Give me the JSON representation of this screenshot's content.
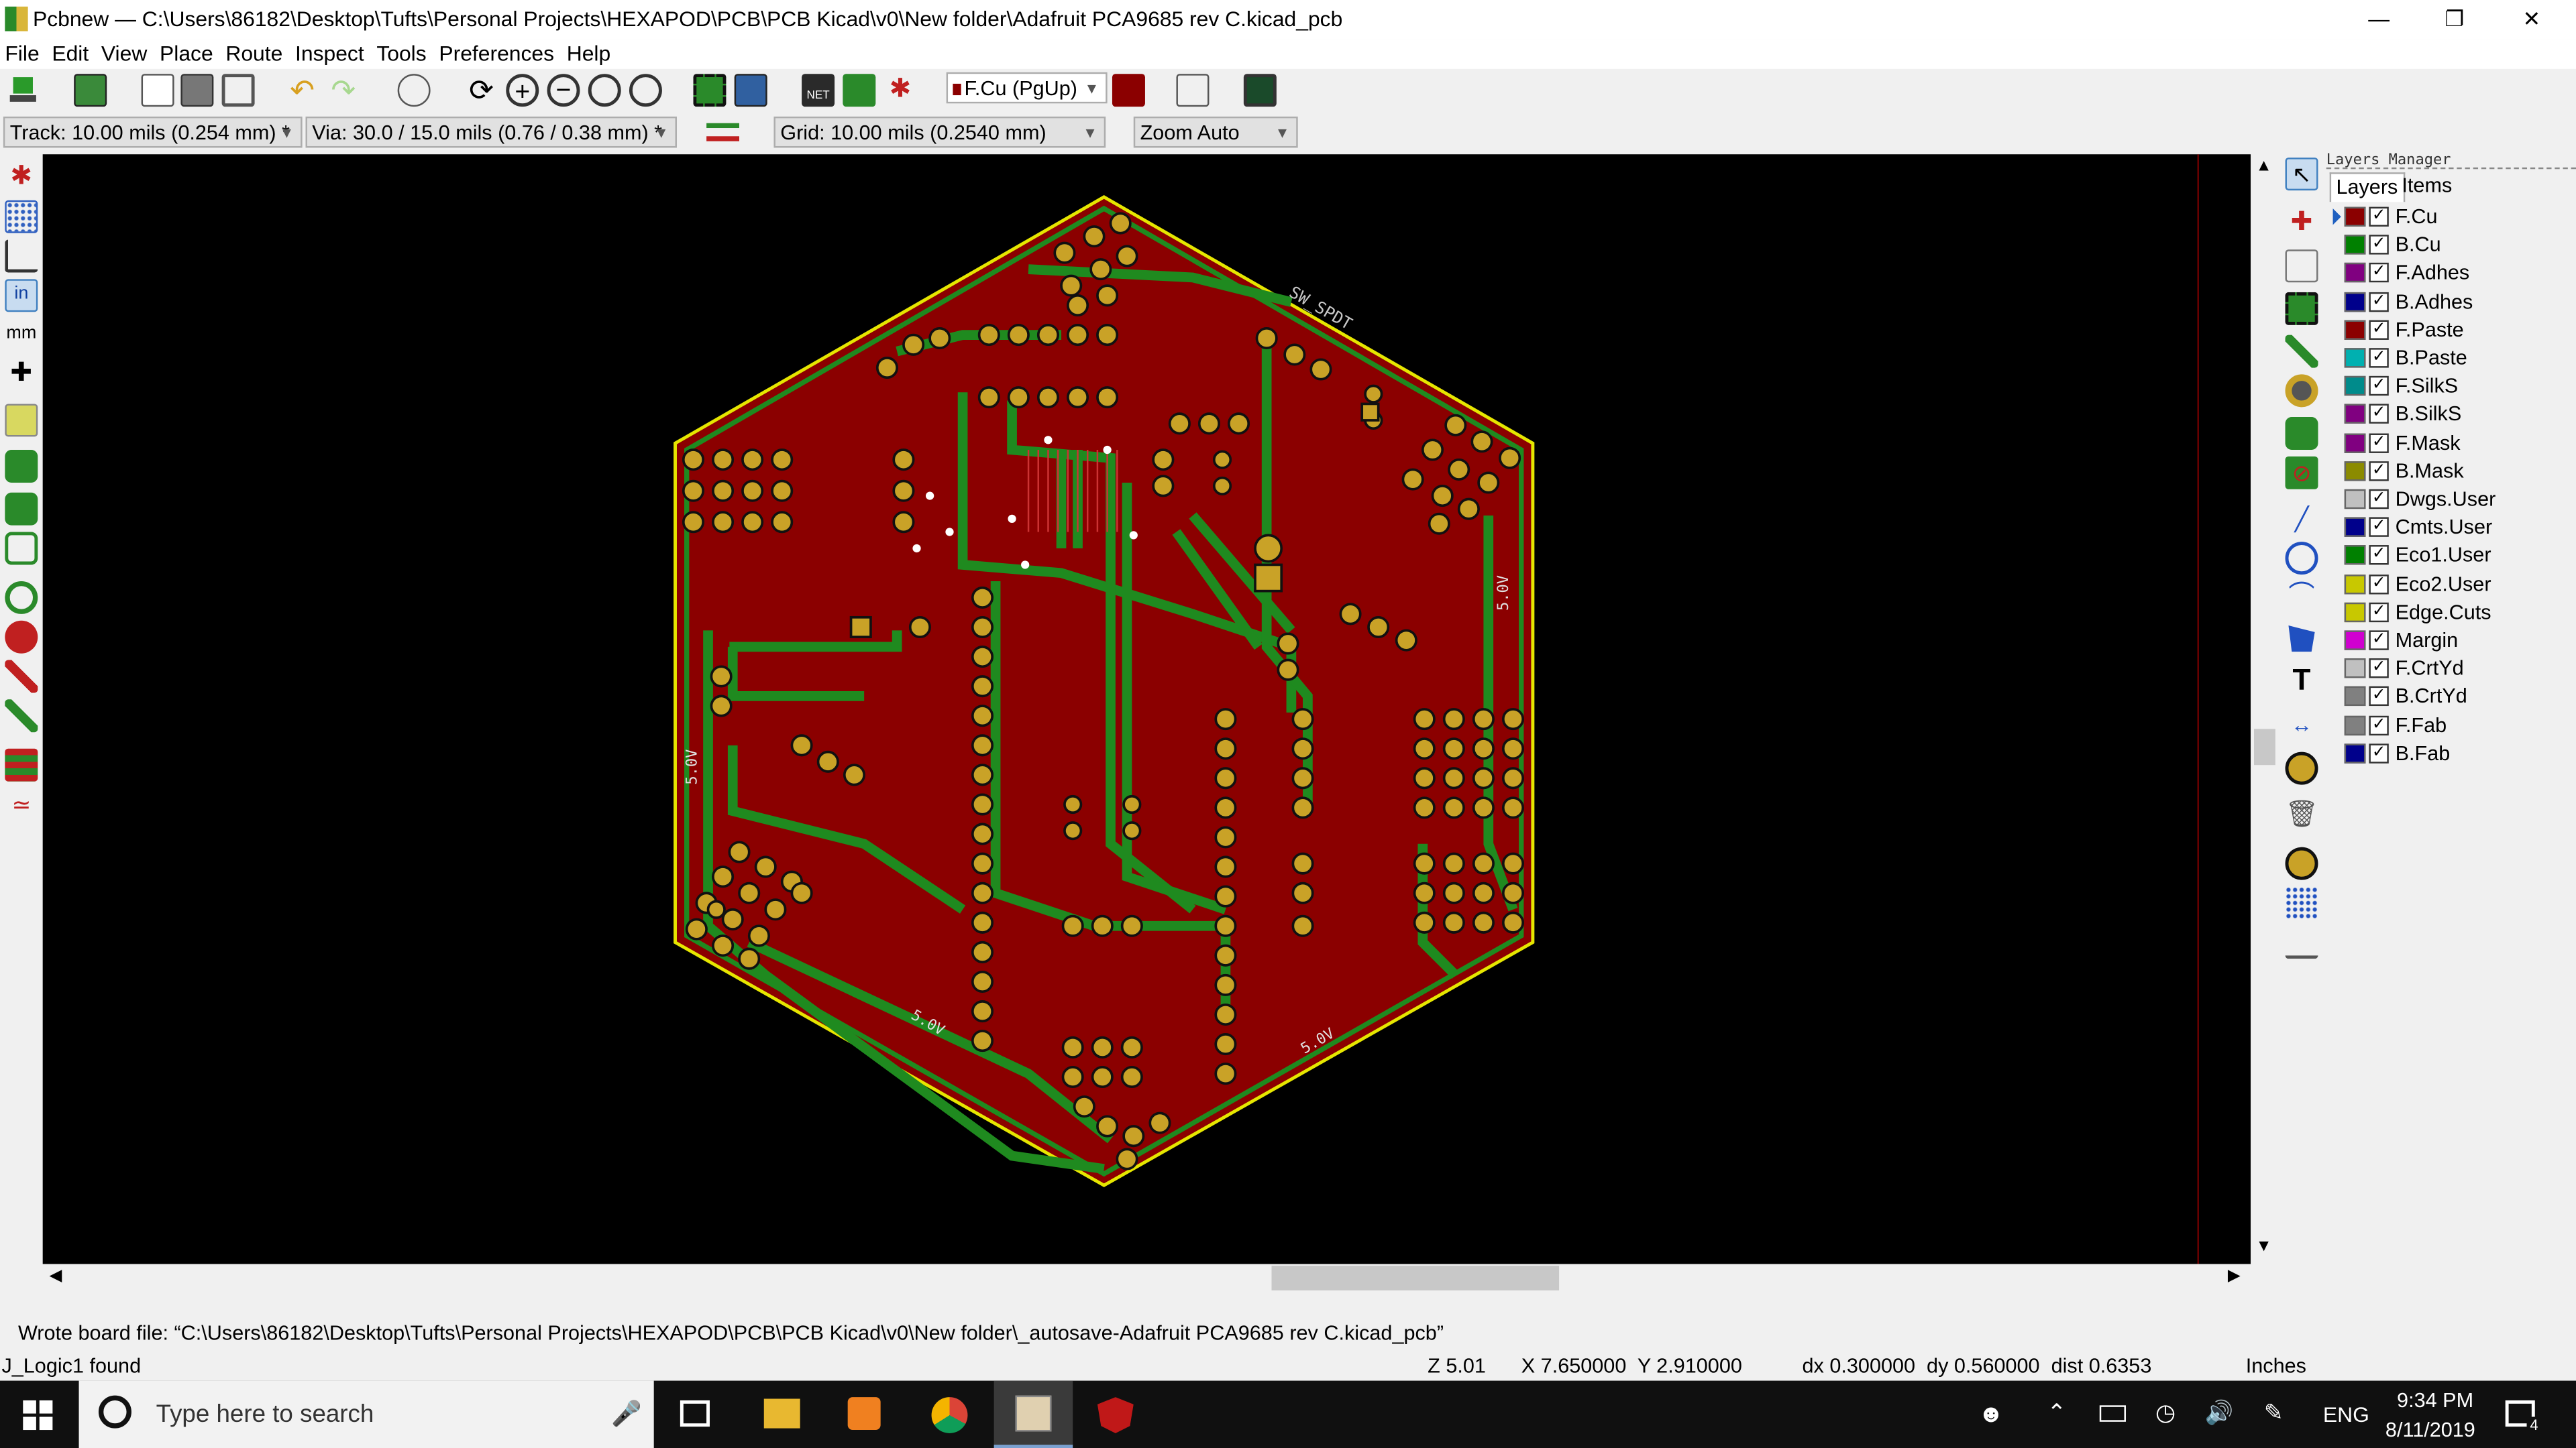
{
  "window": {
    "title": "Pcbnew — C:\\Users\\86182\\Desktop\\Tufts\\Personal Projects\\HEXAPOD\\PCB\\PCB Kicad\\v0\\New folder\\Adafruit PCA9685 rev C.kicad_pcb"
  },
  "menu": [
    "File",
    "Edit",
    "View",
    "Place",
    "Route",
    "Inspect",
    "Tools",
    "Preferences",
    "Help"
  ],
  "toolbar": {
    "layer_select": "F.Cu (PgUp)",
    "track": "Track: 10.00 mils (0.254 mm) *",
    "via": "Via: 30.0 / 15.0 mils (0.76 / 0.38 mm) *",
    "grid": "Grid: 10.00 mils (0.2540 mm)",
    "zoom": "Zoom Auto"
  },
  "left_toolbar_units": {
    "inch": "in",
    "mm": "mm"
  },
  "board": {
    "silk_labels": [
      "SW_SPDT",
      "5.0V",
      "5.0V",
      "5.0V",
      "5.0V"
    ],
    "colors": {
      "copper_fill": "#8b0000",
      "trace": "#1f8a1f",
      "pad": "#c9a227",
      "edge": "#e0e000"
    }
  },
  "layers_manager": {
    "title": "Layers Manager",
    "tabs": [
      "Layers",
      "Items"
    ],
    "active_layer": "F.Cu",
    "layers": [
      {
        "name": "F.Cu",
        "color": "#8b0000",
        "checked": true
      },
      {
        "name": "B.Cu",
        "color": "#008000",
        "checked": true
      },
      {
        "name": "F.Adhes",
        "color": "#800080",
        "checked": true
      },
      {
        "name": "B.Adhes",
        "color": "#00008b",
        "checked": true
      },
      {
        "name": "F.Paste",
        "color": "#8b0000",
        "checked": true
      },
      {
        "name": "B.Paste",
        "color": "#00b0b0",
        "checked": true
      },
      {
        "name": "F.SilkS",
        "color": "#008b8b",
        "checked": true
      },
      {
        "name": "B.SilkS",
        "color": "#800080",
        "checked": true
      },
      {
        "name": "F.Mask",
        "color": "#800080",
        "checked": true
      },
      {
        "name": "B.Mask",
        "color": "#8b8b00",
        "checked": true
      },
      {
        "name": "Dwgs.User",
        "color": "#c0c0c0",
        "checked": true
      },
      {
        "name": "Cmts.User",
        "color": "#00008b",
        "checked": true
      },
      {
        "name": "Eco1.User",
        "color": "#008000",
        "checked": true
      },
      {
        "name": "Eco2.User",
        "color": "#c8c800",
        "checked": true
      },
      {
        "name": "Edge.Cuts",
        "color": "#c8c800",
        "checked": true
      },
      {
        "name": "Margin",
        "color": "#d000d0",
        "checked": true
      },
      {
        "name": "F.CrtYd",
        "color": "#c0c0c0",
        "checked": true
      },
      {
        "name": "B.CrtYd",
        "color": "#808080",
        "checked": true
      },
      {
        "name": "F.Fab",
        "color": "#808080",
        "checked": true
      },
      {
        "name": "B.Fab",
        "color": "#00008b",
        "checked": true
      }
    ]
  },
  "message": "Wrote board file: “C:\\Users\\86182\\Desktop\\Tufts\\Personal Projects\\HEXAPOD\\PCB\\PCB Kicad\\v0\\New folder\\_autosave-Adafruit PCA9685 rev C.kicad_pcb”",
  "status": {
    "left": "J_Logic1 found",
    "zoom": "Z 5.01",
    "xy": "X 7.650000  Y 2.910000",
    "delta": "dx 0.300000  dy 0.560000  dist 0.6353",
    "units": "Inches"
  },
  "taskbar": {
    "search_placeholder": "Type here to search",
    "lang": "ENG",
    "time": "9:34 PM",
    "date": "8/11/2019",
    "notif_count": "4"
  }
}
